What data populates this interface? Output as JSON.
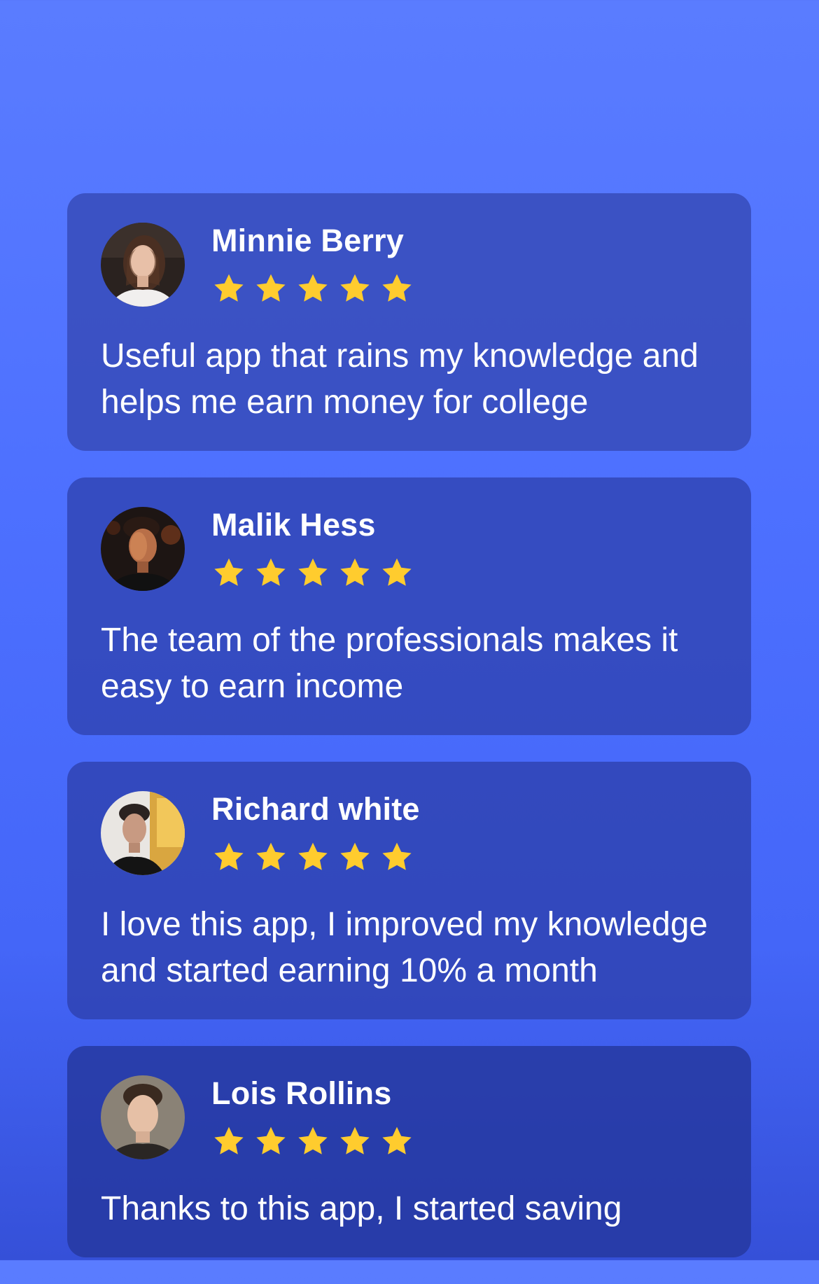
{
  "colors": {
    "background_top": "#5a7cff",
    "background_bottom": "#3550d8",
    "card": "#3a54c0",
    "star": "#ffcc2e",
    "text": "#ffffff"
  },
  "reviews": [
    {
      "name": "Minnie Berry",
      "rating": 5,
      "text": "Useful app that rains my knowledge and helps me earn money for college",
      "avatar_icon": "avatar-photo"
    },
    {
      "name": "Malik Hess",
      "rating": 5,
      "text": "The team of the professionals makes it easy to earn income",
      "avatar_icon": "avatar-photo"
    },
    {
      "name": "Richard white",
      "rating": 5,
      "text": "I love this app, I improved my knowledge and started earning 10% a month",
      "avatar_icon": "avatar-photo"
    },
    {
      "name": "Lois Rollins",
      "rating": 5,
      "text": "Thanks to this app, I started saving",
      "avatar_icon": "avatar-photo"
    }
  ]
}
